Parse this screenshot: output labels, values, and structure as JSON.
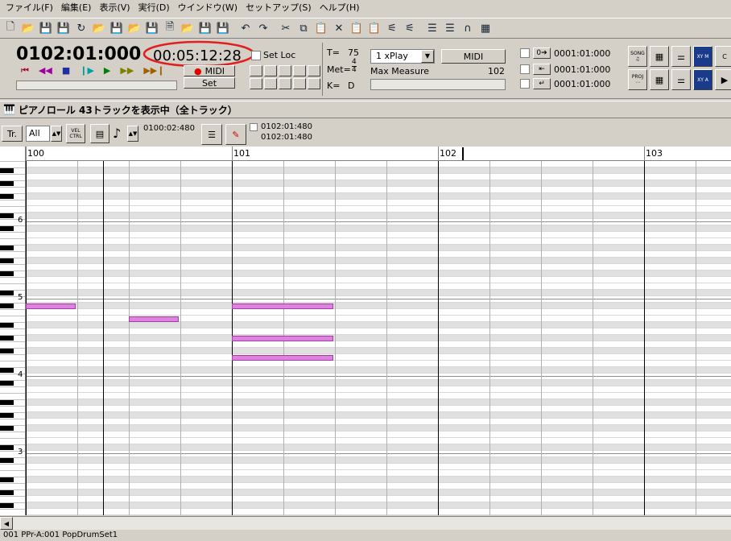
{
  "menubar": {
    "items": [
      "ファイル(F)",
      "編集(E)",
      "表示(V)",
      "実行(D)",
      "ウインドウ(W)",
      "セットアップ(S)",
      "ヘルプ(H)"
    ]
  },
  "toolbar": {
    "icons": [
      "new-file-icon",
      "open-folder-icon",
      "save-icon",
      "save-as-icon",
      "refresh-icon",
      "open-folder-icon",
      "save-icon",
      "open-folder-icon",
      "save-icon",
      "document-icon",
      "open-folder-icon",
      "save-icon",
      "save-icon",
      "undo-icon",
      "redo-icon",
      "cut-icon",
      "copy-icon",
      "paste-icon",
      "delete-icon",
      "paste-special-icon",
      "paste-special-icon",
      "align-icon",
      "align-icon",
      "list-icon",
      "list-icon",
      "headphone-icon",
      "checker-icon"
    ]
  },
  "transport": {
    "measure_counter": "0102:01:000",
    "time_counter": "00:05:12:28",
    "midi_label": "MIDI",
    "set_label": "Set",
    "set_loc_label": "Set Loc",
    "tempo_label": "T=",
    "tempo_value": "75",
    "meter_label": "Met=",
    "meter_top": "4",
    "meter_bottom": "4",
    "key_label": "K=",
    "key_value": "D",
    "play_mode": "1 xPlay",
    "midi_button": "MIDI",
    "max_measure_label": "Max Measure",
    "max_measure_value": "102",
    "loc1": "0001:01:000",
    "loc2": "0001:01:000",
    "loc3": "0001:01:000",
    "mode_buttons": [
      "SONG",
      "PROJ",
      "XY M",
      "XY A"
    ]
  },
  "piano_roll": {
    "title": "ピアノロール 43トラックを表示中（全トラック）",
    "track_label": "Tr.",
    "all_label": "All",
    "vel_label": "VEL CTRL",
    "snap_value": "0100:02:480",
    "pos1": "0102:01:480",
    "pos2": "0102:01:480",
    "measures": [
      "100",
      "101",
      "102",
      "103"
    ],
    "octave_labels": [
      "6",
      "5",
      "4",
      "3"
    ]
  },
  "statusbar": {
    "text": "001 PPr-A:001 PopDrumSet1"
  },
  "colors": {
    "note_fill": "#e080e0",
    "highlight_circle": "#e02020"
  }
}
